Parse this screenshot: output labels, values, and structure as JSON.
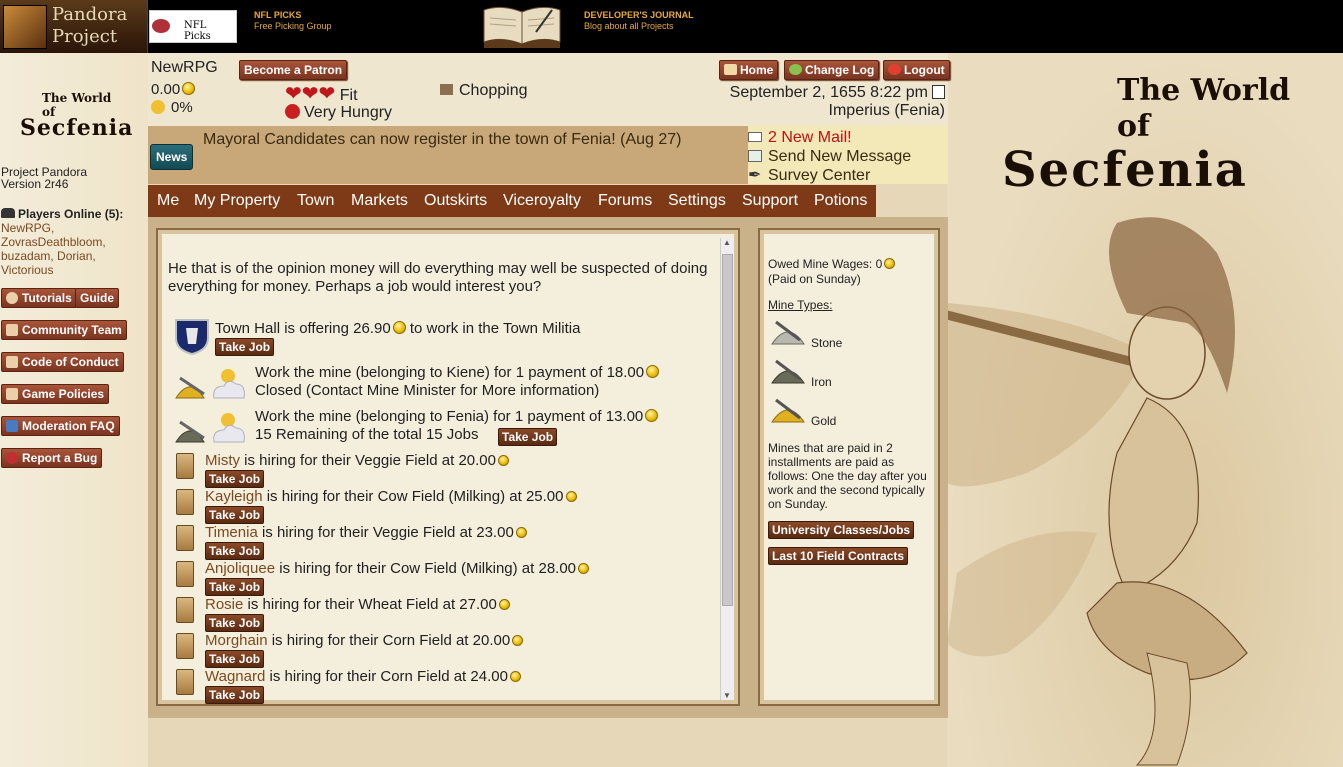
{
  "topbar": {
    "logo_line1": "Pandora",
    "logo_line2": "Project",
    "ad1_label": "NFL Picks",
    "ad1_title": "NFL PICKS",
    "ad1_sub": "Free Picking Group",
    "ad2_title": "DEVELOPER'S JOURNAL",
    "ad2_sub": "Blog about all Projects"
  },
  "left": {
    "project_name": "Project Pandora",
    "version": "Version 2r46",
    "players_online_label": "Players Online (5):",
    "players": [
      "NewRPG,",
      "ZovrasDeathbloom,",
      "buzadam,",
      "Dorian,",
      "Victorious"
    ],
    "buttons": {
      "tutorials": "Tutorials",
      "guide": "Guide",
      "community": "Community Team",
      "conduct": "Code of Conduct",
      "policies": "Game Policies",
      "modfaq": "Moderation FAQ",
      "bug": "Report a Bug"
    }
  },
  "status": {
    "username": "NewRPG",
    "patron_button": "Become a Patron",
    "money": "0.00",
    "energy": "0%",
    "health": "Fit",
    "hunger": "Very Hungry",
    "skill": "Chopping",
    "date": "September 2, 1655 8:22 pm",
    "location": "Imperius (Fenia)",
    "home": "Home",
    "changelog": "Change Log",
    "logout": "Logout"
  },
  "news": {
    "button": "News",
    "text": "Mayoral Candidates can now register in the town of Fenia! (Aug 27)"
  },
  "mail": {
    "new_mail": "2 New Mail!",
    "send": "Send New Message",
    "survey": "Survey Center"
  },
  "nav": [
    "Me",
    "My Property",
    "Town",
    "Markets",
    "Outskirts",
    "Viceroyalty",
    "Forums",
    "Settings",
    "Support",
    "Potions"
  ],
  "jobs": {
    "intro": "He that is of the opinion money will do everything may well be suspected of doing everything for money. Perhaps a job would interest you?",
    "take_job": "Take Job",
    "militia": "Town Hall is offering 26.90",
    "militia_suffix": "to work in the Town Militia",
    "mine1_line1": "Work the mine (belonging to Kiene) for 1 payment of 18.00",
    "mine1_line2": "Closed (Contact Mine Minister for More information)",
    "mine2_line1": "Work the mine (belonging to Fenia) for 1 payment of 13.00",
    "mine2_line2": "15 Remaining of the total 15 Jobs",
    "fields": [
      {
        "name": "Misty",
        "text": "is hiring for their Veggie Field at 20.00"
      },
      {
        "name": "Kayleigh",
        "text": "is hiring for their Cow Field (Milking) at 25.00"
      },
      {
        "name": "Timenia",
        "text": "is hiring for their Veggie Field at 23.00"
      },
      {
        "name": "Anjoliquee",
        "text": "is hiring for their Cow Field (Milking) at 28.00"
      },
      {
        "name": "Rosie",
        "text": "is hiring for their Wheat Field at 27.00"
      },
      {
        "name": "Morghain",
        "text": "is hiring for their Corn Field at 20.00"
      },
      {
        "name": "Wagnard",
        "text": "is hiring for their Corn Field at 24.00"
      }
    ]
  },
  "side": {
    "owed": "Owed Mine Wages: 0",
    "paid": "(Paid on Sunday)",
    "mine_types_label": "Mine Types:",
    "mine_types": [
      "Stone",
      "Iron",
      "Gold"
    ],
    "note": "Mines that are paid in 2 installments are paid as follows: One the day after you work and the second typically on Sunday.",
    "btn_university": "University Classes/Jobs",
    "btn_contracts": "Last 10 Field Contracts"
  },
  "brand": {
    "line1": "The World of",
    "line2": "Secfenia"
  }
}
